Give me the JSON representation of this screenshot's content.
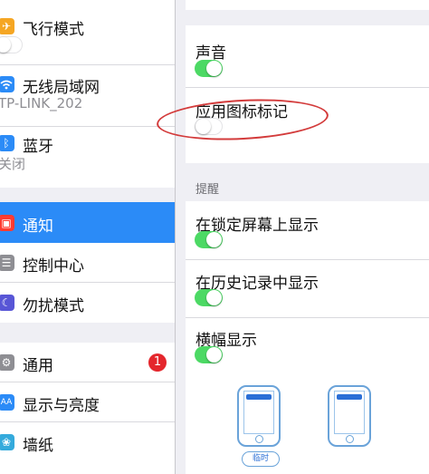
{
  "sidebar": {
    "items": [
      {
        "label": "飞行模式",
        "icon": "airplane-icon",
        "color": "#f5a623"
      },
      {
        "label": "无线局域网",
        "sub": "TP-LINK_202",
        "icon": "wifi-icon",
        "color": "#2b8bf7"
      },
      {
        "label": "蓝牙",
        "sub": "关闭",
        "icon": "bluetooth-icon",
        "color": "#2b8bf7"
      },
      {
        "label": "通知",
        "icon": "notifications-icon",
        "color": "#ff3b30",
        "selected": true
      },
      {
        "label": "控制中心",
        "icon": "control-center-icon",
        "color": "#8e8e93"
      },
      {
        "label": "勿扰模式",
        "icon": "moon-icon",
        "color": "#5856d6"
      },
      {
        "label": "通用",
        "icon": "gear-icon",
        "color": "#8e8e93",
        "badge": "1"
      },
      {
        "label": "显示与亮度",
        "icon": "display-brightness-icon",
        "color": "#2b8bf7"
      },
      {
        "label": "墙纸",
        "icon": "wallpaper-icon",
        "color": "#34aadc"
      }
    ],
    "airplane_toggle": "off"
  },
  "detail": {
    "sound_label": "声音",
    "sound_toggle": "on",
    "badge_label": "应用图标标记",
    "badge_toggle": "off",
    "alerts_header": "提醒",
    "lock_screen_label": "在锁定屏幕上显示",
    "lock_screen_toggle": "on",
    "history_label": "在历史记录中显示",
    "history_toggle": "on",
    "banner_label": "横幅显示",
    "banner_toggle": "on",
    "banner_style_temporary": "临时"
  },
  "colors": {
    "accent": "#2b8bf7",
    "toggle_on": "#4cd964",
    "annotation": "#d33b3b"
  }
}
